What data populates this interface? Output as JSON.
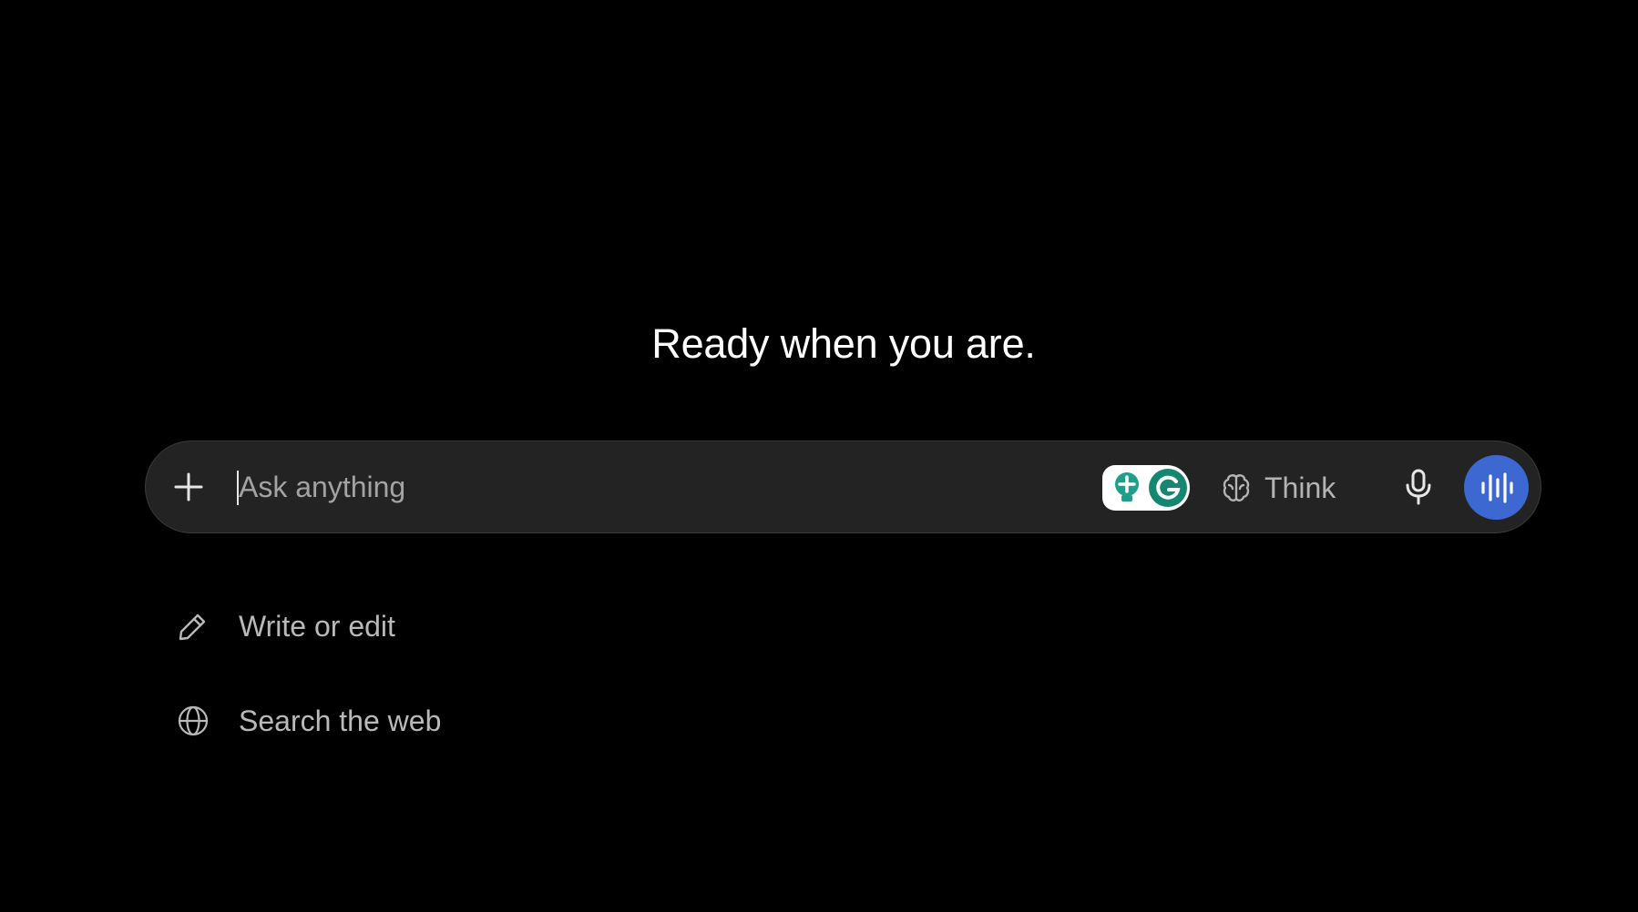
{
  "headline": "Ready when you are.",
  "composer": {
    "placeholder": "Ask anything",
    "add_icon": "plus-icon",
    "grammarly_icon": "grammarly-icon",
    "think_label": "Think",
    "think_icon": "brain-icon",
    "mic_icon": "microphone-icon",
    "voice_icon": "voice-waveform-icon",
    "voice_color": "#3d67d1"
  },
  "suggestions": [
    {
      "label": "Write or edit",
      "icon": "pencil-icon"
    },
    {
      "label": "Search the web",
      "icon": "globe-icon"
    }
  ]
}
